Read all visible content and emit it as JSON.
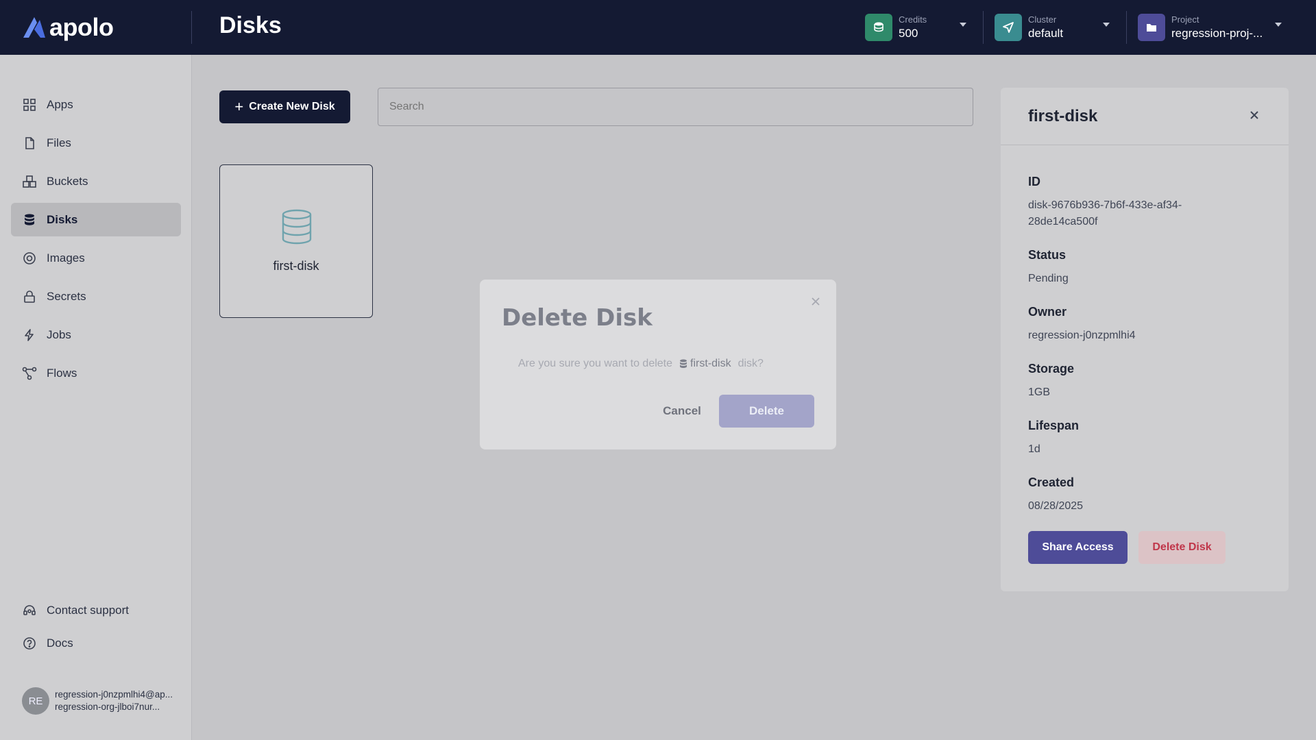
{
  "app": {
    "logo": "apolo",
    "page_title": "Disks"
  },
  "header": {
    "credits": {
      "label": "Credits",
      "value": "500",
      "icon": "coins-icon",
      "color": "#2f8a6a"
    },
    "cluster": {
      "label": "Cluster",
      "value": "default",
      "icon": "send-icon",
      "color": "#3a8c90"
    },
    "project": {
      "label": "Project",
      "value": "regression-proj-...",
      "icon": "folder-icon",
      "color": "#4e4c98"
    }
  },
  "sidebar": {
    "items": [
      {
        "label": "Apps",
        "icon": "apps-grid-icon"
      },
      {
        "label": "Files",
        "icon": "file-icon"
      },
      {
        "label": "Buckets",
        "icon": "buckets-icon"
      },
      {
        "label": "Disks",
        "icon": "database-icon",
        "active": true
      },
      {
        "label": "Images",
        "icon": "images-icon"
      },
      {
        "label": "Secrets",
        "icon": "lock-icon"
      },
      {
        "label": "Jobs",
        "icon": "lightning-icon"
      },
      {
        "label": "Flows",
        "icon": "flows-icon"
      }
    ],
    "footer": [
      {
        "label": "Contact support",
        "icon": "headset-icon"
      },
      {
        "label": "Docs",
        "icon": "help-circle-icon"
      }
    ],
    "user": {
      "initials": "RE",
      "email": "regression-j0nzpmlhi4@ap...",
      "org": "regression-org-jlboi7nur..."
    }
  },
  "toolbar": {
    "create_label": "Create New Disk",
    "search_placeholder": "Search"
  },
  "disks": [
    {
      "name": "first-disk"
    }
  ],
  "details": {
    "title": "first-disk",
    "fields": {
      "id": {
        "label": "ID",
        "value": "disk-9676b936-7b6f-433e-af34-28de14ca500f"
      },
      "status": {
        "label": "Status",
        "value": "Pending"
      },
      "owner": {
        "label": "Owner",
        "value": "regression-j0nzpmlhi4"
      },
      "storage": {
        "label": "Storage",
        "value": "1GB"
      },
      "lifespan": {
        "label": "Lifespan",
        "value": "1d"
      },
      "created": {
        "label": "Created",
        "value": "08/28/2025"
      }
    },
    "share_label": "Share Access",
    "delete_label": "Delete Disk"
  },
  "modal": {
    "title": "Delete Disk",
    "text_before": "Are you sure you want to delete",
    "disk_name": "first-disk",
    "text_after": "disk?",
    "cancel_label": "Cancel",
    "delete_label": "Delete"
  }
}
